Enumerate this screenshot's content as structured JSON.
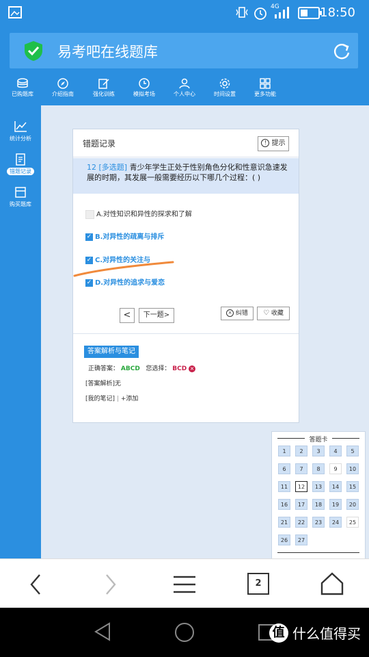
{
  "status_bar": {
    "network": "4G",
    "time": "18:50"
  },
  "browser": {
    "page_title": "易考吧在线题库",
    "tab_count": "2"
  },
  "site_nav": {
    "items": [
      {
        "label": "已购题库",
        "icon": "database-icon"
      },
      {
        "label": "介绍指南",
        "icon": "compass-icon"
      },
      {
        "label": "强化训练",
        "icon": "edit-icon"
      },
      {
        "label": "模拟考场",
        "icon": "clock-icon"
      },
      {
        "label": "个人中心",
        "icon": "user-icon"
      },
      {
        "label": "时间设置",
        "icon": "gear-icon"
      },
      {
        "label": "更多功能",
        "icon": "grid-icon"
      }
    ]
  },
  "sidebar": {
    "items": [
      {
        "label": "统计分析",
        "icon": "chart-line-icon"
      },
      {
        "label": "错题记录",
        "icon": "notepad-icon"
      },
      {
        "label": "购买题库",
        "icon": "store-icon"
      }
    ]
  },
  "card": {
    "title": "错题记录",
    "hint_label": "提示",
    "question_number": "12",
    "question_type": "[多选题]",
    "question_text": "青少年学生正处于性别角色分化和性意识急速发展的时期，其发展一般需要经历以下哪几个过程：( )",
    "options": [
      {
        "text": "A.对性知识和异性的探求和了解",
        "checked": false
      },
      {
        "text": "B.对异性的疏离与排斥",
        "checked": true
      },
      {
        "text": "C.对异性的关注与",
        "checked": true
      },
      {
        "text": "D.对异性的追求与爱恋",
        "checked": true
      }
    ],
    "prev_symbol": "<",
    "next_label": "下一题",
    "next_symbol": ">",
    "report_label": "纠错",
    "collect_label": "收藏",
    "analysis_tab": "答案解析与笔记",
    "correct_label": "正确答案：",
    "correct_value": "ABCD",
    "chosen_label": "您选择：",
    "chosen_value": "BCD",
    "analysis_text": "[答案解析]无",
    "notes_label": "[我的笔记]",
    "add_label": "+添加"
  },
  "answer_card": {
    "title": "答题卡",
    "numbers": [
      "1",
      "2",
      "3",
      "4",
      "5",
      "6",
      "7",
      "8",
      "9",
      "10",
      "11",
      "12",
      "13",
      "14",
      "15",
      "16",
      "17",
      "18",
      "19",
      "20",
      "21",
      "22",
      "23",
      "24",
      "25",
      "26",
      "27"
    ],
    "current": "12",
    "blank": [
      "9",
      "25"
    ]
  },
  "colors": {
    "primary": "#2b8fe0",
    "correct": "#2aa83e",
    "wrong": "#c8204a",
    "highlight": "#f08a3c"
  }
}
